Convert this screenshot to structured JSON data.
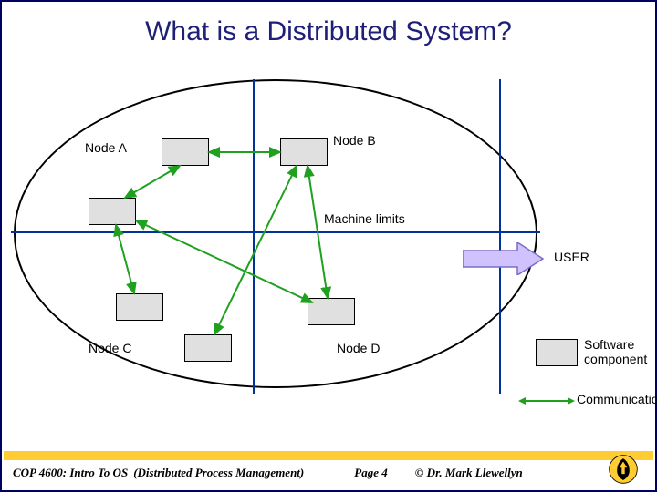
{
  "title": "What is a Distributed System?",
  "nodes": {
    "a": "Node A",
    "b": "Node B",
    "c": "Node C",
    "d": "Node D"
  },
  "labels": {
    "machine_limits": "Machine limits",
    "user": "USER",
    "software_component": "Software component",
    "communication": "Communication"
  },
  "footer": {
    "course": "COP 4600: Intro To OS",
    "subtitle": "(Distributed Process Management)",
    "page": "Page 4",
    "author": "© Dr. Mark Llewellyn"
  },
  "colors": {
    "accent": "#003399",
    "arrow": "#1fa01f",
    "block_arrow_fill": "#cfc2ff",
    "block_arrow_stroke": "#7c6cc4",
    "gold": "#ffcc33"
  }
}
